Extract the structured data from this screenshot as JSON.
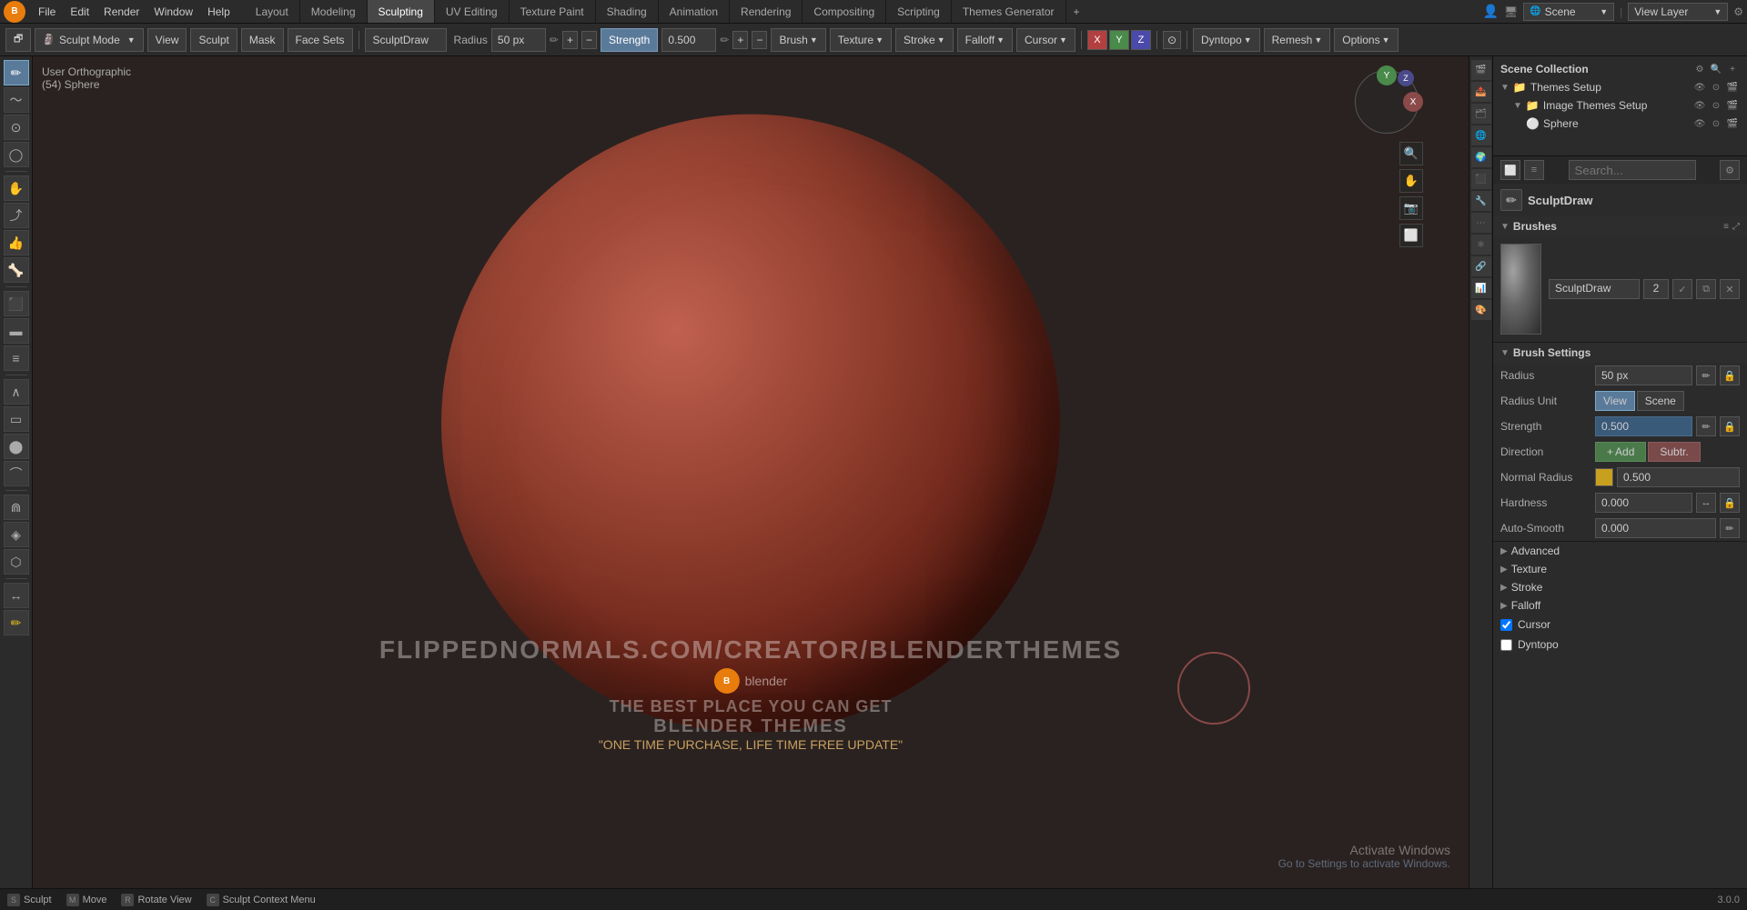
{
  "app": {
    "title": "Blender",
    "icon": "B"
  },
  "topbar": {
    "menus": [
      "File",
      "Edit",
      "Render",
      "Window",
      "Help"
    ],
    "workspaces": [
      "Layout",
      "Modeling",
      "Sculpting",
      "UV Editing",
      "Texture Paint",
      "Shading",
      "Animation",
      "Rendering",
      "Compositing",
      "Scripting",
      "Themes Generator"
    ],
    "active_workspace": "Sculpting",
    "scene_label": "Scene",
    "view_layer_label": "View Layer",
    "plus_icon": "+"
  },
  "toolbar": {
    "mode": "Sculpt Mode",
    "view_label": "View",
    "sculpt_label": "Sculpt",
    "mask_label": "Mask",
    "face_sets_label": "Face Sets",
    "brush_name": "SculptDraw",
    "radius_label": "Radius",
    "radius_value": "50 px",
    "strength_label": "Strength",
    "strength_value": "0.500",
    "brush_label": "Brush",
    "texture_label": "Texture",
    "stroke_label": "Stroke",
    "falloff_label": "Falloff",
    "cursor_label": "Cursor",
    "dyntopo_label": "Dyntopo",
    "remesh_label": "Remesh",
    "options_label": "Options",
    "x_label": "X",
    "y_label": "Y",
    "z_label": "Z"
  },
  "viewport": {
    "info_line1": "User Orthographic",
    "info_line2": "(54) Sphere",
    "watermark_url": "FLIPPEDNORMALS.COM/CREATOR/BLENDERTHEMES",
    "blender_label": "blender",
    "tagline1": "THE BEST PLACE YOU CAN GET",
    "tagline2": "BLENDER THEMES",
    "tagline3": "\"ONE TIME PURCHASE, LIFE TIME FREE UPDATE\"",
    "gizmo_y": "Y",
    "gizmo_x": "X",
    "gizmo_z": "Z"
  },
  "outliner": {
    "title": "Scene Collection",
    "items": [
      {
        "label": "Themes Setup",
        "icon": "📁",
        "level": 1
      },
      {
        "label": "Image Themes Setup",
        "icon": "🖼️",
        "level": 2
      },
      {
        "label": "Sphere",
        "icon": "⚪",
        "level": 3
      }
    ]
  },
  "properties": {
    "search_placeholder": "Search...",
    "brushes_title": "Brushes",
    "brush_name": "SculptDraw",
    "brush_count": "2",
    "brush_settings_title": "Brush Settings",
    "radius_label": "Radius",
    "radius_value": "50 px",
    "radius_unit_label": "Radius Unit",
    "view_label": "View",
    "scene_label": "Scene",
    "strength_label": "Strength",
    "strength_value": "0.500",
    "direction_label": "Direction",
    "add_label": "Add",
    "subtract_label": "Subtr.",
    "normal_radius_label": "Normal Radius",
    "normal_radius_value": "0.500",
    "hardness_label": "Hardness",
    "hardness_value": "0.000",
    "auto_smooth_label": "Auto-Smooth",
    "auto_smooth_value": "0.000",
    "advanced_label": "Advanced",
    "texture_label": "Texture",
    "stroke_label": "Stroke",
    "falloff_label": "Falloff",
    "cursor_label": "Cursor",
    "dyntopo_label": "Dyntopo"
  },
  "activate_windows": {
    "line1": "Activate Windows",
    "line2": "Go to Settings to activate Windows.",
    "link_text": "Activate Windows"
  },
  "statusbar": {
    "sculpt_label": "Sculpt",
    "move_label": "Move",
    "rotate_label": "Rotate View",
    "context_label": "Sculpt Context Menu",
    "version": "3.0.0"
  }
}
